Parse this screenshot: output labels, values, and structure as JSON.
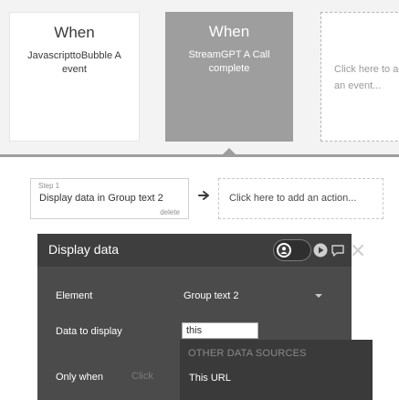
{
  "events": [
    {
      "when": "When",
      "description": "JavascripttoBubble A event"
    },
    {
      "when": "When",
      "description": "StreamGPT A Call complete"
    },
    {
      "when": "",
      "description": "Click here to add an event..."
    }
  ],
  "action_step": {
    "step_label": "Step 1",
    "title": "Display data in Group text 2",
    "delete_label": "delete"
  },
  "add_action_label": "Click here to add an action...",
  "panel": {
    "title": "Display data",
    "fields": {
      "element_label": "Element",
      "element_value": "Group text 2",
      "data_label": "Data to display",
      "data_value": "this",
      "only_when_label": "Only when",
      "only_when_placeholder": "Click"
    }
  },
  "dropdown": {
    "header": "OTHER DATA SOURCES",
    "items": [
      "This URL"
    ]
  },
  "colors": {
    "selected_event": "#9e9e9e",
    "panel_bg": "#4b4b4b",
    "panel_header": "#3e3e3e",
    "dropdown_bg": "#3a3a3a"
  },
  "icons": [
    "arrow-right-icon",
    "user-icon",
    "play-icon",
    "chat-icon",
    "close-icon",
    "chevron-down-icon"
  ]
}
